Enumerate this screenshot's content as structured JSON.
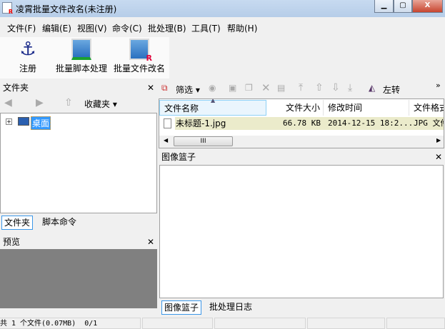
{
  "window": {
    "title": "凌霄批量文件改名(未注册)",
    "minimize": "▁",
    "maximize": "▢",
    "close": "X"
  },
  "menu": [
    "文件(F)",
    "编辑(E)",
    "视图(V)",
    "命令(C)",
    "批处理(B)",
    "工具(T)",
    "帮助(H)"
  ],
  "toolbar": [
    {
      "label": "注册",
      "icon": "anchor-icon"
    },
    {
      "label": "批量脚本处理",
      "icon": "script-image-icon"
    },
    {
      "label": "批量文件改名",
      "icon": "rename-image-icon"
    }
  ],
  "folder_panel": {
    "title": "文件夹",
    "favorites": "收藏夹",
    "tree": [
      {
        "label": "桌面",
        "selected": true
      }
    ],
    "tabs": [
      "文件夹",
      "脚本命令"
    ]
  },
  "preview_panel": {
    "title": "预览"
  },
  "file_toolbar": {
    "filter": "筛选",
    "rotate_left": "左转",
    "more": "»"
  },
  "file_list": {
    "columns": [
      "文件名称",
      "文件大小",
      "修改时间",
      "文件格式"
    ],
    "rows": [
      {
        "name": "未标题-1.jpg",
        "size": "66.78 KB",
        "modified": "2014-12-15 18:2...",
        "format": "JPG 文件"
      }
    ],
    "scroll_grip": "III"
  },
  "basket_panel": {
    "title": "图像篮子",
    "tabs": [
      "图像篮子",
      "批处理日志"
    ]
  },
  "status": {
    "text": "共 1 个文件(0.07MB)  0/1"
  }
}
